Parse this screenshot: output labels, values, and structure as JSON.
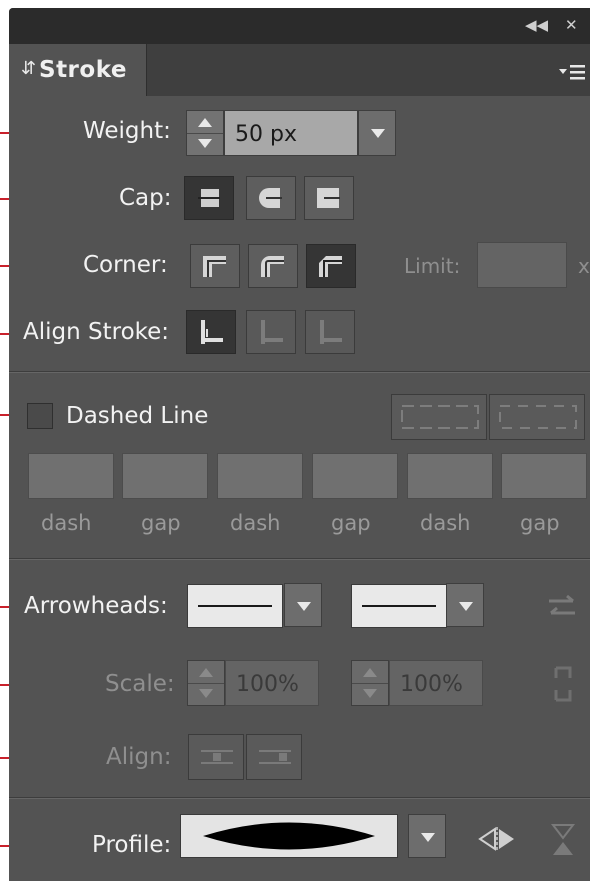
{
  "panel": {
    "tab_label": "Stroke",
    "icons": {
      "collapse": "double-left-arrow-icon",
      "close": "close-icon",
      "menu": "panel-menu-icon",
      "tab_updown": "updown-arrows-icon"
    }
  },
  "weight": {
    "label": "Weight:",
    "value": "50 px"
  },
  "cap": {
    "label": "Cap:",
    "options": [
      "butt-cap",
      "round-cap",
      "projecting-cap"
    ],
    "selected": "butt-cap"
  },
  "corner": {
    "label": "Corner:",
    "options": [
      "miter-join",
      "round-join",
      "bevel-join"
    ],
    "selected": "bevel-join",
    "limit_label": "Limit:",
    "limit_suffix": "x"
  },
  "align_stroke": {
    "label": "Align Stroke:",
    "options": [
      "center",
      "inside",
      "outside"
    ],
    "selected": "center"
  },
  "dashed_line": {
    "label": "Dashed Line",
    "checked": false,
    "fields": [
      "dash",
      "gap",
      "dash",
      "gap",
      "dash",
      "gap"
    ]
  },
  "arrowheads": {
    "label": "Arrowheads:",
    "start": "none",
    "end": "none"
  },
  "scale": {
    "label": "Scale:",
    "start_value": "100%",
    "end_value": "100%"
  },
  "align": {
    "label": "Align:"
  },
  "profile": {
    "label": "Profile:"
  },
  "colors": {
    "panel_bg": "#535353",
    "callout": "#c8202b",
    "header": "#2b2b2b"
  }
}
